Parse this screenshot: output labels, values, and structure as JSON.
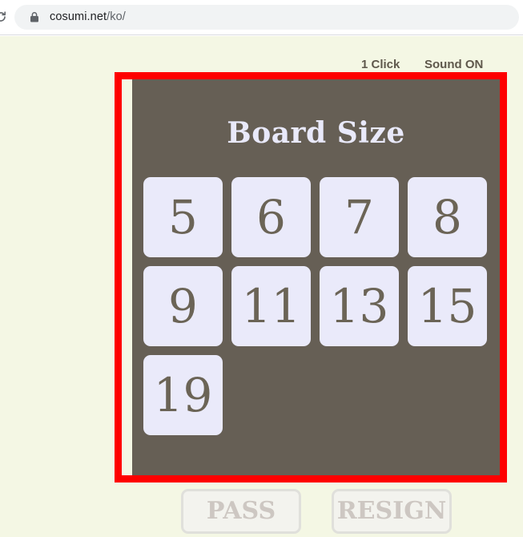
{
  "browser": {
    "reload_icon": "reload-icon",
    "lock_icon": "lock-icon",
    "url_domain": "cosumi.net",
    "url_path": "/ko/"
  },
  "status": {
    "click_mode": "1 Click",
    "sound": "Sound ON"
  },
  "board": {
    "title": "Board Size",
    "rows": [
      [
        "5",
        "6",
        "7",
        "8"
      ],
      [
        "9",
        "11",
        "13",
        "15"
      ],
      [
        "19"
      ]
    ]
  },
  "actions": {
    "pass": "PASS",
    "resign": "RESIGN"
  },
  "colors": {
    "page_background": "#f4f7e4",
    "panel": "#665f55",
    "button": "#eaeafa",
    "button_text": "#6b6456",
    "title_text": "#e9e9fa",
    "annotation": "#fe0000",
    "status_text": "#5f584c",
    "action_text": "#cdc7c2"
  }
}
